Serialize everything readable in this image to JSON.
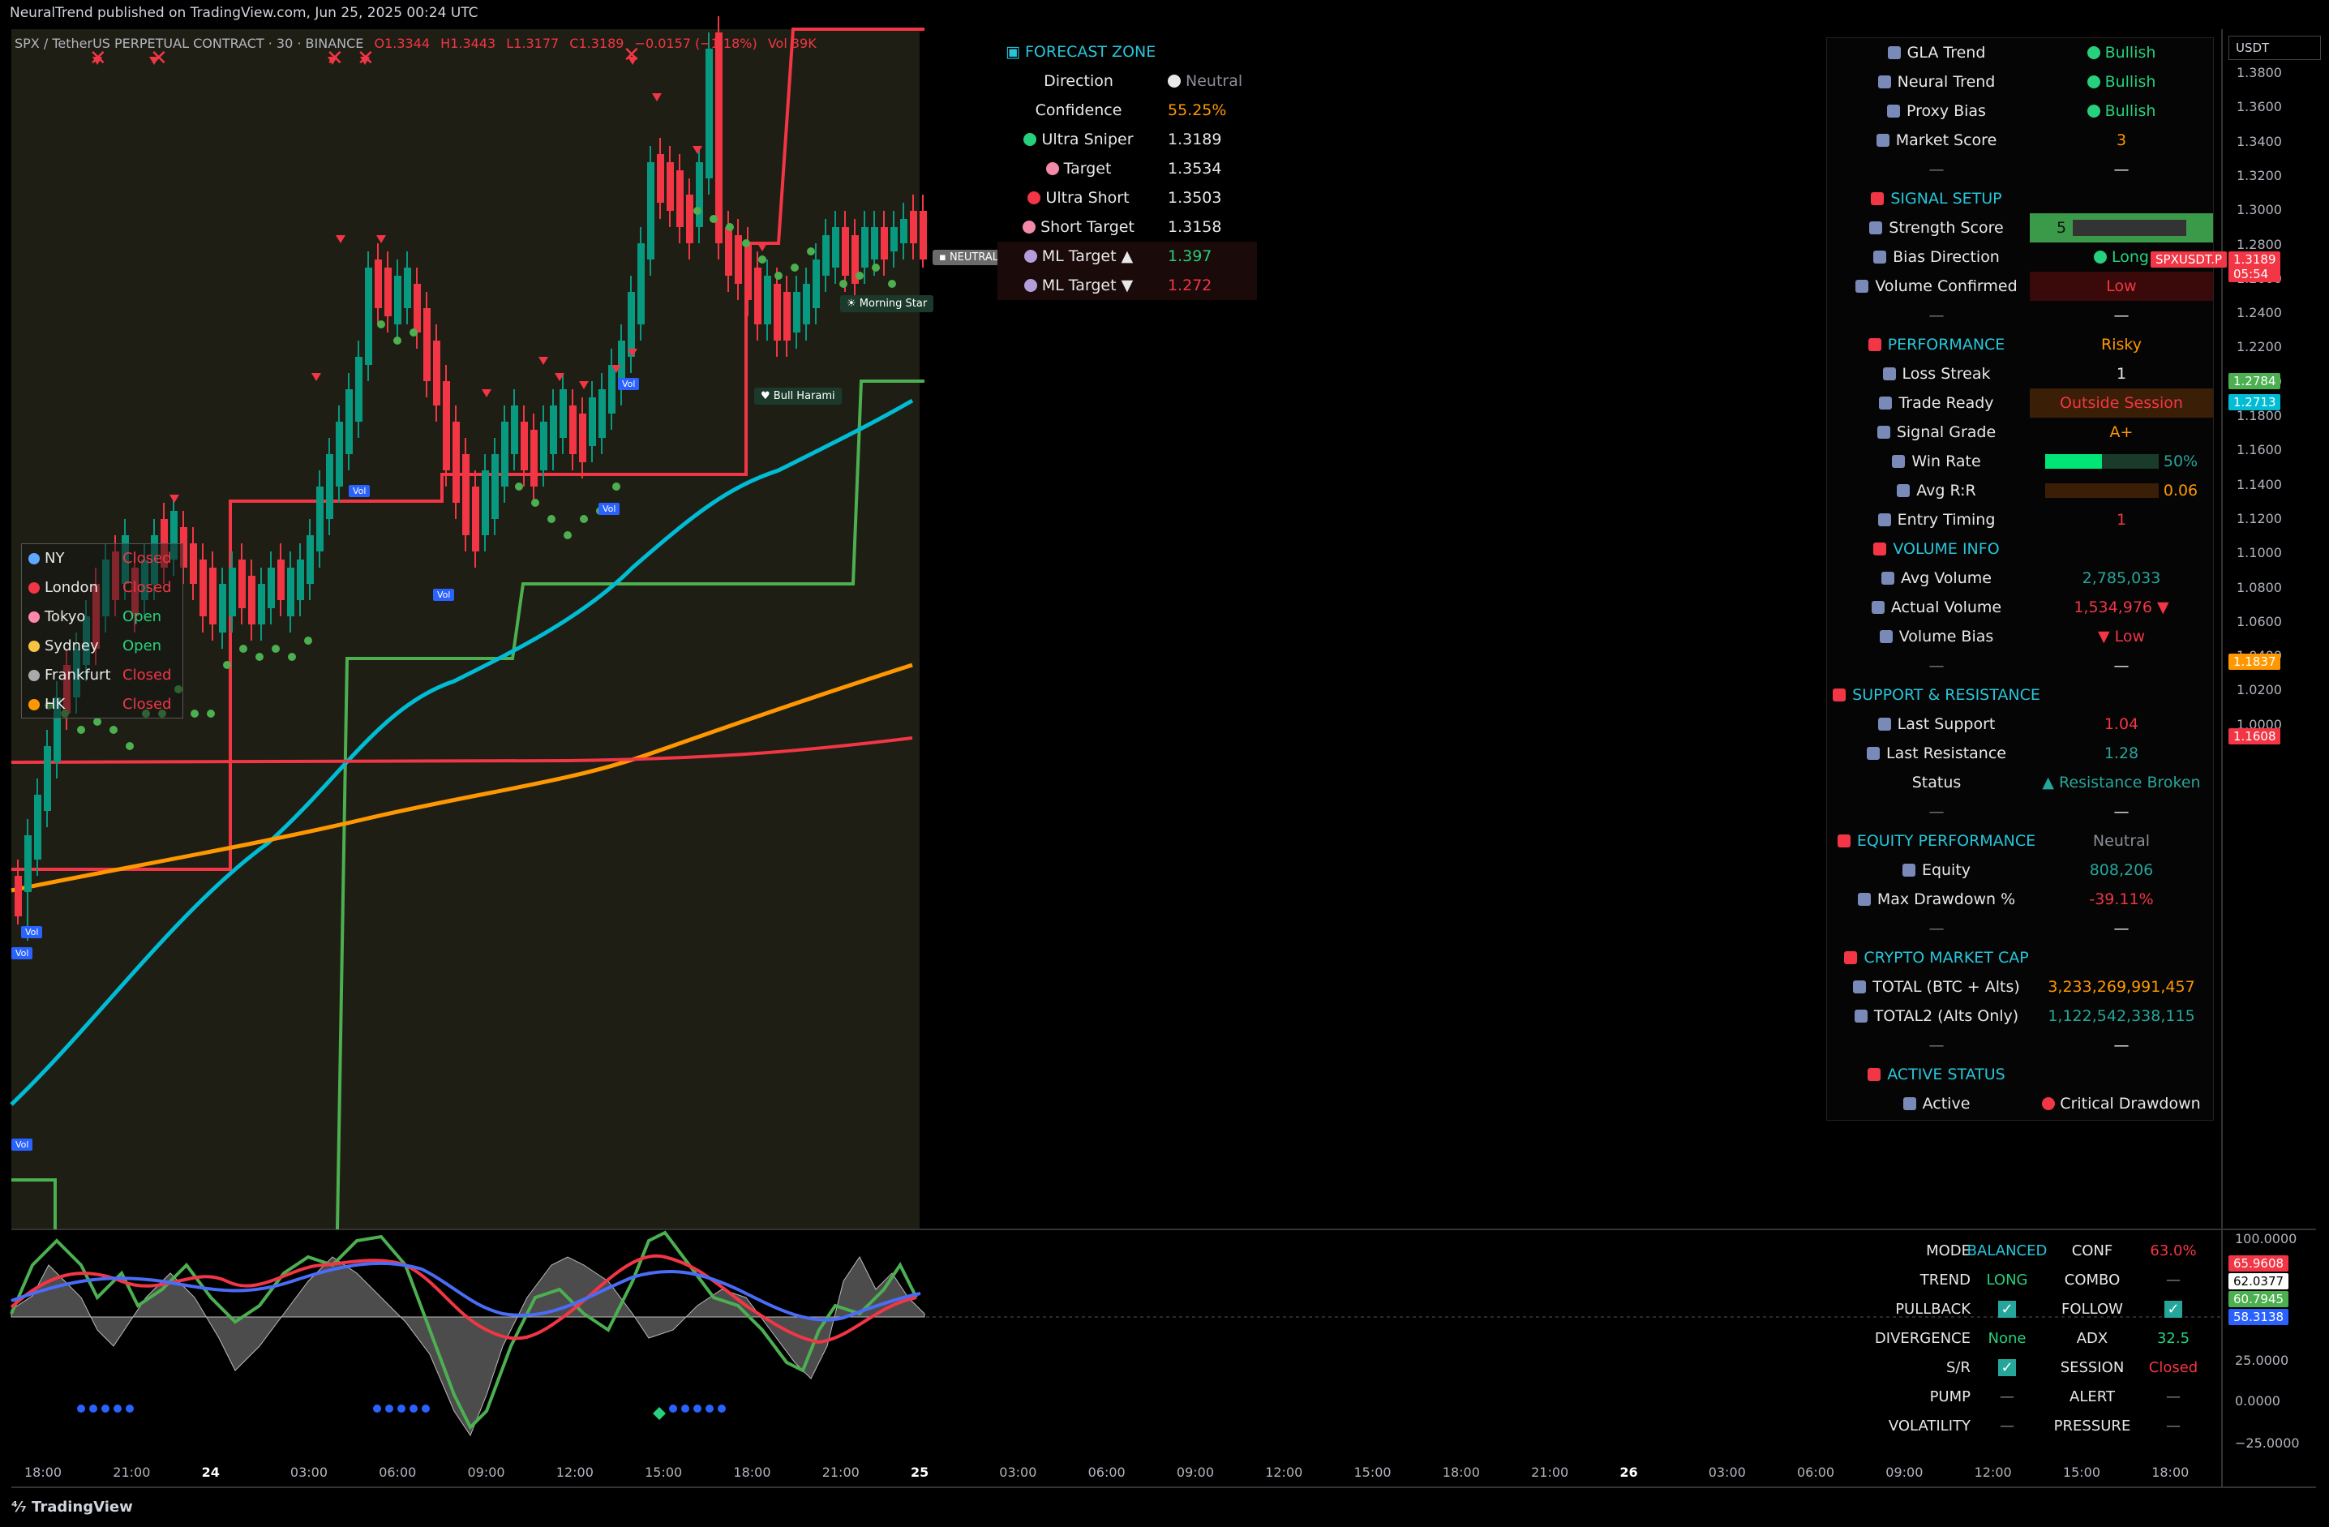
{
  "header": {
    "published": "NeuralTrend published on TradingView.com, Jun 25, 2025 00:24 UTC",
    "symbol": "SPX / TetherUS PERPETUAL CONTRACT · 30 · BINANCE",
    "open": "O1.3344",
    "high": "H1.3443",
    "low": "L1.3177",
    "close": "C1.3189",
    "change": "−0.0157 (−1.18%)",
    "vol": "Vol 39K"
  },
  "forecast": {
    "title": "FORECAST ZONE",
    "rows": [
      {
        "label": "Direction",
        "value": "Neutral",
        "icon": "white-dot"
      },
      {
        "label": "Confidence",
        "value": "55.25%"
      },
      {
        "label": "Ultra Sniper",
        "value": "1.3189",
        "icon": "green-dot"
      },
      {
        "label": "Target",
        "value": "1.3534",
        "icon": "target-icon"
      },
      {
        "label": "Ultra Short",
        "value": "1.3503",
        "icon": "red-dot"
      },
      {
        "label": "Short Target",
        "value": "1.3158",
        "icon": "target-icon"
      },
      {
        "label": "ML Target ▲",
        "value": "1.397",
        "icon": "robot-icon"
      },
      {
        "label": "ML Target ▼",
        "value": "1.272",
        "icon": "robot-icon"
      }
    ]
  },
  "right_panel": {
    "rows": [
      {
        "label": "GLA Trend",
        "value": "Bullish"
      },
      {
        "label": "Neural Trend",
        "value": "Bullish"
      },
      {
        "label": "Proxy Bias",
        "value": "Bullish"
      },
      {
        "label": "Market Score",
        "value": "3"
      },
      {
        "label": "—",
        "value": "—"
      },
      {
        "label": "SIGNAL SETUP",
        "value": ""
      },
      {
        "label": "Strength Score",
        "value": "5"
      },
      {
        "label": "Bias Direction",
        "value": "Long"
      },
      {
        "label": "Volume Confirmed",
        "value": "Low"
      },
      {
        "label": "—",
        "value": "—"
      },
      {
        "label": "PERFORMANCE",
        "value": "Risky"
      },
      {
        "label": "Loss Streak",
        "value": "1"
      },
      {
        "label": "Trade Ready",
        "value": "Outside Session"
      },
      {
        "label": "Signal Grade",
        "value": "A+"
      },
      {
        "label": "Win Rate",
        "value": "50%"
      },
      {
        "label": "Avg R:R",
        "value": "0.06"
      },
      {
        "label": "Entry Timing",
        "value": "1"
      },
      {
        "label": "VOLUME INFO",
        "value": ""
      },
      {
        "label": "Avg Volume",
        "value": "2,785,033"
      },
      {
        "label": "Actual Volume",
        "value": "1,534,976 ▼"
      },
      {
        "label": "Volume Bias",
        "value": "▼ Low"
      },
      {
        "label": "—",
        "value": "—"
      },
      {
        "label": "SUPPORT & RESISTANCE",
        "value": ""
      },
      {
        "label": "Last Support",
        "value": "1.04"
      },
      {
        "label": "Last Resistance",
        "value": "1.28"
      },
      {
        "label": "Status",
        "value": "▲ Resistance Broken"
      },
      {
        "label": "—",
        "value": "—"
      },
      {
        "label": "EQUITY PERFORMANCE",
        "value": "Neutral"
      },
      {
        "label": "Equity",
        "value": "808,206"
      },
      {
        "label": "Max Drawdown %",
        "value": "-39.11%"
      },
      {
        "label": "—",
        "value": "—"
      },
      {
        "label": "CRYPTO MARKET CAP",
        "value": ""
      },
      {
        "label": "TOTAL (BTC + Alts)",
        "value": "3,233,269,991,457"
      },
      {
        "label": "TOTAL2 (Alts Only)",
        "value": "1,122,542,338,115"
      },
      {
        "label": "—",
        "value": "—"
      },
      {
        "label": "ACTIVE STATUS",
        "value": ""
      },
      {
        "label": "Active",
        "value": "Critical Drawdown"
      }
    ]
  },
  "sessions": [
    {
      "name": "NY",
      "status": "Closed"
    },
    {
      "name": "London",
      "status": "Closed"
    },
    {
      "name": "Tokyo",
      "status": "Open"
    },
    {
      "name": "Sydney",
      "status": "Open"
    },
    {
      "name": "Frankfurt",
      "status": "Closed"
    },
    {
      "name": "HK",
      "status": "Closed"
    }
  ],
  "price_axis": {
    "currency": "USDT",
    "ticks": [
      "1.3800",
      "1.3600",
      "1.3400",
      "1.3200",
      "1.3000",
      "1.2800",
      "1.2600",
      "1.2400",
      "1.2200",
      "1.2000",
      "1.1800",
      "1.1600",
      "1.1400",
      "1.1200",
      "1.1000",
      "1.0800",
      "1.0600",
      "1.0400",
      "1.0200",
      "1.0000"
    ],
    "tags": [
      {
        "text": "1.3189",
        "sub": "05:54",
        "color": "#f23645"
      },
      {
        "text": "1.2784",
        "color": "#4caf50"
      },
      {
        "text": "1.2713",
        "color": "#00bcd4"
      },
      {
        "text": "1.1837",
        "color": "#ff9800"
      },
      {
        "text": "1.1608",
        "color": "#f23645"
      }
    ],
    "symbol_tag": "SPXUSDT.P"
  },
  "osc_axis": {
    "ticks": [
      "100.0000",
      "50.0000",
      "25.0000",
      "0.0000",
      "−25.0000"
    ],
    "tags": [
      {
        "text": "65.9608",
        "color": "#f23645"
      },
      {
        "text": "62.0377",
        "color": "#ffffff"
      },
      {
        "text": "60.7945",
        "color": "#4caf50"
      },
      {
        "text": "58.3138",
        "color": "#2962ff"
      }
    ]
  },
  "time_axis": [
    "18:00",
    "21:00",
    "24",
    "03:00",
    "06:00",
    "09:00",
    "12:00",
    "15:00",
    "18:00",
    "21:00",
    "25",
    "03:00",
    "06:00",
    "09:00",
    "12:00",
    "15:00",
    "18:00",
    "21:00",
    "26",
    "03:00",
    "06:00",
    "09:00",
    "12:00",
    "15:00",
    "18:00"
  ],
  "osc_table": [
    {
      "k1": "MODE",
      "v1": "BALANCED",
      "k2": "CONF",
      "v2": "63.0%"
    },
    {
      "k1": "TREND",
      "v1": "LONG",
      "k2": "COMBO",
      "v2": "—"
    },
    {
      "k1": "PULLBACK",
      "v1": "✓",
      "k2": "FOLLOW",
      "v2": "✓"
    },
    {
      "k1": "DIVERGENCE",
      "v1": "None",
      "k2": "ADX",
      "v2": "32.5"
    },
    {
      "k1": "S/R",
      "v1": "✓",
      "k2": "SESSION",
      "v2": "Closed"
    },
    {
      "k1": "PUMP",
      "v1": "—",
      "k2": "ALERT",
      "v2": "—"
    },
    {
      "k1": "VOLATILITY",
      "v1": "—",
      "k2": "PRESSURE",
      "v2": "—"
    }
  ],
  "annotations": {
    "neutral": "NEUTRAL",
    "morning_star": "Morning Star",
    "bull_harami": "Bull Harami",
    "vol_tag": "Vol"
  },
  "footer": {
    "brand": "TradingView"
  },
  "chart_data": {
    "type": "line",
    "ylim": [
      1.0,
      1.39
    ],
    "series": [
      {
        "color": "#f23645",
        "values": [
          1.116,
          1.116,
          1.116,
          1.116,
          1.116,
          1.116,
          1.116,
          1.116,
          1.116,
          1.116,
          1.116,
          1.116,
          1.116,
          1.116,
          1.116,
          1.116,
          1.116,
          1.116,
          1.116,
          1.116,
          1.116,
          1.116,
          1.116,
          1.116,
          1.116,
          1.116,
          1.116,
          1.116,
          1.116,
          1.116,
          1.116,
          1.116,
          1.116,
          1.116,
          1.116,
          1.116,
          1.116,
          1.116,
          1.116,
          1.116,
          1.116,
          1.116,
          1.116,
          1.116,
          1.116,
          1.116,
          1.116,
          1.116,
          1.116,
          1.116,
          1.116,
          1.116,
          1.116,
          1.116,
          1.116,
          1.116,
          1.116,
          1.116,
          1.116,
          1.116,
          1.116,
          1.116,
          1.116,
          1.116,
          1.116,
          1.116,
          1.116,
          1.116,
          1.116,
          1.116,
          1.116,
          1.116,
          1.116,
          1.116,
          1.116,
          1.116,
          1.116,
          1.116,
          1.116,
          1.116,
          1.116,
          1.116,
          1.116,
          1.116,
          1.116,
          1.116,
          1.116,
          1.116,
          1.116,
          1.116,
          1.116,
          1.116,
          1.116,
          1.116,
          1.116,
          1.116,
          1.116,
          1.116,
          1.116,
          1.116,
          1.116,
          1.116,
          1.116,
          1.116,
          1.116,
          1.116,
          1.116,
          1.116,
          1.116,
          1.116,
          1.116,
          1.116,
          1.116,
          1.116,
          1.116,
          1.116,
          1.116,
          1.116,
          1.116,
          1.116,
          1.116,
          1.116,
          1.116
        ]
      }
    ]
  }
}
